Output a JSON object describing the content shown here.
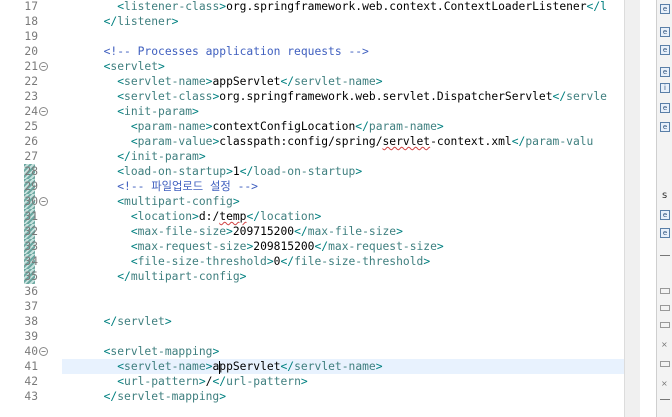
{
  "editor": {
    "lines": [
      {
        "num": "17",
        "indent": "    ",
        "segs": [
          [
            "br",
            "<"
          ],
          [
            "tg",
            "listener-class"
          ],
          [
            "br",
            ">"
          ],
          [
            "tx",
            "org.springframework.web.context.ContextLoaderListener"
          ],
          [
            "br",
            "</l"
          ]
        ]
      },
      {
        "num": "18",
        "indent": "  ",
        "segs": [
          [
            "br",
            "</"
          ],
          [
            "tg",
            "listener"
          ],
          [
            "br",
            ">"
          ]
        ]
      },
      {
        "num": "19",
        "indent": "",
        "segs": []
      },
      {
        "num": "20",
        "indent": "  ",
        "segs": [
          [
            "cm",
            "<!-- Processes application requests -->"
          ]
        ]
      },
      {
        "num": "21",
        "indent": "  ",
        "fold": true,
        "segs": [
          [
            "br",
            "<"
          ],
          [
            "tg",
            "servlet"
          ],
          [
            "br",
            ">"
          ]
        ]
      },
      {
        "num": "22",
        "indent": "    ",
        "segs": [
          [
            "br",
            "<"
          ],
          [
            "tg",
            "servlet-name"
          ],
          [
            "br",
            ">"
          ],
          [
            "tx",
            "appServlet"
          ],
          [
            "br",
            "</"
          ],
          [
            "tg",
            "servlet-name"
          ],
          [
            "br",
            ">"
          ]
        ]
      },
      {
        "num": "23",
        "indent": "    ",
        "segs": [
          [
            "br",
            "<"
          ],
          [
            "tg",
            "servlet-class"
          ],
          [
            "br",
            ">"
          ],
          [
            "tx",
            "org.springframework.web.servlet.DispatcherServlet"
          ],
          [
            "br",
            "</"
          ],
          [
            "tg",
            "servle"
          ]
        ]
      },
      {
        "num": "24",
        "indent": "    ",
        "fold": true,
        "segs": [
          [
            "br",
            "<"
          ],
          [
            "tg",
            "init-param"
          ],
          [
            "br",
            ">"
          ]
        ]
      },
      {
        "num": "25",
        "indent": "      ",
        "segs": [
          [
            "br",
            "<"
          ],
          [
            "tg",
            "param-name"
          ],
          [
            "br",
            ">"
          ],
          [
            "tx",
            "contextConfigLocation"
          ],
          [
            "br",
            "</"
          ],
          [
            "tg",
            "param-name"
          ],
          [
            "br",
            ">"
          ]
        ]
      },
      {
        "num": "26",
        "indent": "      ",
        "segs": [
          [
            "br",
            "<"
          ],
          [
            "tg",
            "param-value"
          ],
          [
            "br",
            ">"
          ],
          [
            "tx",
            "classpath:config/spring/"
          ],
          [
            "sq",
            "servlet"
          ],
          [
            "tx",
            "-context.xml"
          ],
          [
            "br",
            "</"
          ],
          [
            "tg",
            "param-valu"
          ]
        ]
      },
      {
        "num": "27",
        "indent": "    ",
        "segs": [
          [
            "br",
            "</"
          ],
          [
            "tg",
            "init-param"
          ],
          [
            "br",
            ">"
          ]
        ]
      },
      {
        "num": "28",
        "indent": "    ",
        "change": true,
        "segs": [
          [
            "br",
            "<"
          ],
          [
            "tg",
            "load-on-startup"
          ],
          [
            "br",
            ">"
          ],
          [
            "tx",
            "1"
          ],
          [
            "br",
            "</"
          ],
          [
            "tg",
            "load-on-startup"
          ],
          [
            "br",
            ">"
          ]
        ]
      },
      {
        "num": "29",
        "indent": "    ",
        "change": true,
        "segs": [
          [
            "cm",
            "<!-- 파일업로드 설정 -->"
          ]
        ]
      },
      {
        "num": "30",
        "indent": "    ",
        "change": true,
        "fold": true,
        "segs": [
          [
            "br",
            "<"
          ],
          [
            "tg",
            "multipart-config"
          ],
          [
            "br",
            ">"
          ]
        ]
      },
      {
        "num": "31",
        "indent": "      ",
        "change": true,
        "segs": [
          [
            "br",
            "<"
          ],
          [
            "tg",
            "location"
          ],
          [
            "br",
            ">"
          ],
          [
            "tx",
            "d:/"
          ],
          [
            "sq",
            "temp"
          ],
          [
            "br",
            "</"
          ],
          [
            "tg",
            "location"
          ],
          [
            "br",
            ">"
          ]
        ]
      },
      {
        "num": "32",
        "indent": "      ",
        "change": true,
        "segs": [
          [
            "br",
            "<"
          ],
          [
            "tg",
            "max-file-size"
          ],
          [
            "br",
            ">"
          ],
          [
            "tx",
            "209715200"
          ],
          [
            "br",
            "</"
          ],
          [
            "tg",
            "max-file-size"
          ],
          [
            "br",
            ">"
          ]
        ]
      },
      {
        "num": "33",
        "indent": "      ",
        "change": true,
        "segs": [
          [
            "br",
            "<"
          ],
          [
            "tg",
            "max-request-size"
          ],
          [
            "br",
            ">"
          ],
          [
            "tx",
            "209815200"
          ],
          [
            "br",
            "</"
          ],
          [
            "tg",
            "max-request-size"
          ],
          [
            "br",
            ">"
          ]
        ]
      },
      {
        "num": "34",
        "indent": "      ",
        "change": true,
        "segs": [
          [
            "br",
            "<"
          ],
          [
            "tg",
            "file-size-threshold"
          ],
          [
            "br",
            ">"
          ],
          [
            "tx",
            "0"
          ],
          [
            "br",
            "</"
          ],
          [
            "tg",
            "file-size-threshold"
          ],
          [
            "br",
            ">"
          ]
        ]
      },
      {
        "num": "35",
        "indent": "    ",
        "change": true,
        "segs": [
          [
            "br",
            "</"
          ],
          [
            "tg",
            "multipart-config"
          ],
          [
            "br",
            ">"
          ]
        ]
      },
      {
        "num": "36",
        "indent": "",
        "segs": []
      },
      {
        "num": "37",
        "indent": "",
        "segs": []
      },
      {
        "num": "38",
        "indent": "  ",
        "segs": [
          [
            "br",
            "</"
          ],
          [
            "tg",
            "servlet"
          ],
          [
            "br",
            ">"
          ]
        ]
      },
      {
        "num": "39",
        "indent": "",
        "segs": []
      },
      {
        "num": "40",
        "indent": "  ",
        "fold": true,
        "segs": [
          [
            "br",
            "<"
          ],
          [
            "tg",
            "servlet-mapping"
          ],
          [
            "br",
            ">"
          ]
        ]
      },
      {
        "num": "41",
        "indent": "    ",
        "current": true,
        "segs": [
          [
            "br",
            "<"
          ],
          [
            "tg",
            "servlet-name"
          ],
          [
            "br",
            ">"
          ],
          [
            "tx",
            "a"
          ],
          [
            "caret",
            ""
          ],
          [
            "tx",
            "ppServlet"
          ],
          [
            "br",
            "</"
          ],
          [
            "tg",
            "servlet-name"
          ],
          [
            "br",
            ">"
          ]
        ]
      },
      {
        "num": "42",
        "indent": "    ",
        "segs": [
          [
            "br",
            "<"
          ],
          [
            "tg",
            "url-pattern"
          ],
          [
            "br",
            ">"
          ],
          [
            "tx",
            "/"
          ],
          [
            "br",
            "</"
          ],
          [
            "tg",
            "url-pattern"
          ],
          [
            "br",
            ">"
          ]
        ]
      },
      {
        "num": "43",
        "indent": "  ",
        "segs": [
          [
            "br",
            "</"
          ],
          [
            "tg",
            "servlet-mapping"
          ],
          [
            "br",
            ">"
          ]
        ]
      }
    ]
  },
  "side_panel": {
    "items": [
      {
        "type": "icon",
        "glyph": "e"
      },
      {
        "type": "icon",
        "glyph": "e"
      },
      {
        "type": "icon",
        "glyph": "e"
      },
      {
        "type": "icon",
        "glyph": "e"
      },
      {
        "type": "icon",
        "glyph": "i"
      },
      {
        "type": "icon",
        "glyph": "e"
      },
      {
        "type": "icon",
        "glyph": "e"
      },
      {
        "type": "text",
        "glyph": "s"
      },
      {
        "type": "icon",
        "glyph": "e"
      },
      {
        "type": "icon",
        "glyph": "e"
      }
    ]
  },
  "colors": {
    "tag_bracket": "#008080",
    "tag_name": "#3f7f7f",
    "comment": "#3f5fbf",
    "current_line": "#e8f2fe",
    "change_marker": "#6aa7a0"
  }
}
